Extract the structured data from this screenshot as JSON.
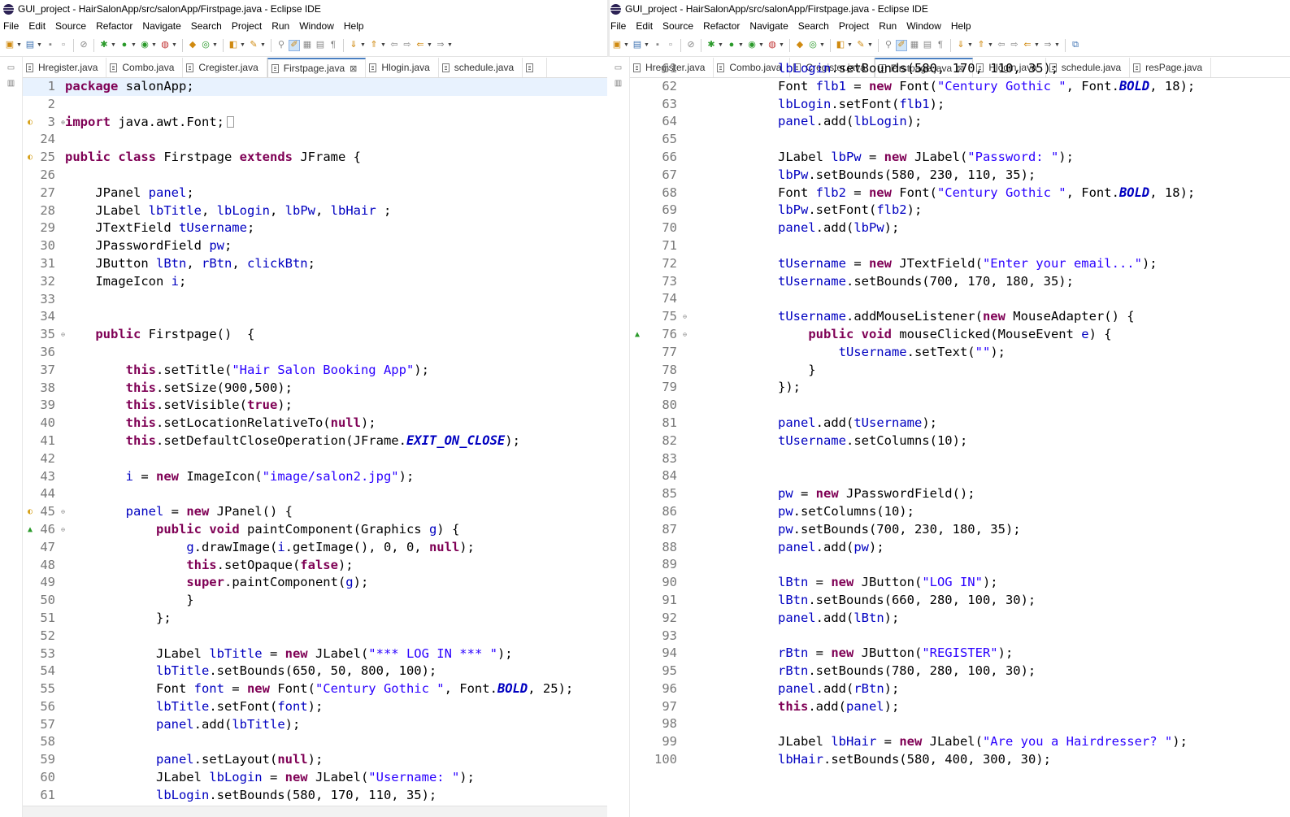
{
  "window_title": "GUI_project - HairSalonApp/src/salonApp/Firstpage.java - Eclipse IDE",
  "menu": [
    "File",
    "Edit",
    "Source",
    "Refactor",
    "Navigate",
    "Search",
    "Project",
    "Run",
    "Window",
    "Help"
  ],
  "left_tabs": [
    {
      "label": "Hregister.java",
      "active": false
    },
    {
      "label": "Combo.java",
      "active": false
    },
    {
      "label": "Cregister.java",
      "active": false
    },
    {
      "label": "Firstpage.java",
      "active": true
    },
    {
      "label": "Hlogin.java",
      "active": false
    },
    {
      "label": "schedule.java",
      "active": false
    }
  ],
  "right_tabs": [
    {
      "label": "Hregister.java",
      "active": false
    },
    {
      "label": "Combo.java",
      "active": false
    },
    {
      "label": "Cregister.java",
      "active": false
    },
    {
      "label": "Firstpage.java",
      "active": true
    },
    {
      "label": "Hlogin.java",
      "active": false
    },
    {
      "label": "schedule.java",
      "active": false
    },
    {
      "label": "resPage.java",
      "active": false
    }
  ],
  "close_glyph": "⊠",
  "left_code": [
    {
      "n": "1",
      "t": "package salonApp;",
      "current": true
    },
    {
      "n": "2",
      "t": ""
    },
    {
      "n": "3",
      "t": "import java.awt.Font;",
      "marker": "warn",
      "fold": "expand",
      "collapsed": true
    },
    {
      "n": "24",
      "t": ""
    },
    {
      "n": "25",
      "t": "public class Firstpage extends JFrame {",
      "marker": "warn"
    },
    {
      "n": "26",
      "t": ""
    },
    {
      "n": "27",
      "t": "    JPanel panel;"
    },
    {
      "n": "28",
      "t": "    JLabel lbTitle, lbLogin, lbPw, lbHair ;"
    },
    {
      "n": "29",
      "t": "    JTextField tUsername;"
    },
    {
      "n": "30",
      "t": "    JPasswordField pw;"
    },
    {
      "n": "31",
      "t": "    JButton lBtn, rBtn, clickBtn;"
    },
    {
      "n": "32",
      "t": "    ImageIcon i;"
    },
    {
      "n": "33",
      "t": ""
    },
    {
      "n": "34",
      "t": ""
    },
    {
      "n": "35",
      "t": "    public Firstpage()  {",
      "fold": "collapse"
    },
    {
      "n": "36",
      "t": ""
    },
    {
      "n": "37",
      "t": "        this.setTitle(\"Hair Salon Booking App\");"
    },
    {
      "n": "38",
      "t": "        this.setSize(900,500);"
    },
    {
      "n": "39",
      "t": "        this.setVisible(true);"
    },
    {
      "n": "40",
      "t": "        this.setLocationRelativeTo(null);"
    },
    {
      "n": "41",
      "t": "        this.setDefaultCloseOperation(JFrame.EXIT_ON_CLOSE);"
    },
    {
      "n": "42",
      "t": ""
    },
    {
      "n": "43",
      "t": "        i = new ImageIcon(\"image/salon2.jpg\");"
    },
    {
      "n": "44",
      "t": ""
    },
    {
      "n": "45",
      "t": "        panel = new JPanel() {",
      "marker": "warn",
      "fold": "collapse"
    },
    {
      "n": "46",
      "t": "            public void paintComponent(Graphics g) {",
      "marker": "up",
      "fold": "collapse"
    },
    {
      "n": "47",
      "t": "                g.drawImage(i.getImage(), 0, 0, null);"
    },
    {
      "n": "48",
      "t": "                this.setOpaque(false);"
    },
    {
      "n": "49",
      "t": "                super.paintComponent(g);"
    },
    {
      "n": "50",
      "t": "                }"
    },
    {
      "n": "51",
      "t": "            };"
    },
    {
      "n": "52",
      "t": ""
    },
    {
      "n": "53",
      "t": "            JLabel lbTitle = new JLabel(\"*** LOG IN *** \");"
    },
    {
      "n": "54",
      "t": "            lbTitle.setBounds(650, 50, 800, 100);"
    },
    {
      "n": "55",
      "t": "            Font font = new Font(\"Century Gothic \", Font.BOLD, 25);"
    },
    {
      "n": "56",
      "t": "            lbTitle.setFont(font);"
    },
    {
      "n": "57",
      "t": "            panel.add(lbTitle);"
    },
    {
      "n": "58",
      "t": ""
    },
    {
      "n": "59",
      "t": "            panel.setLayout(null);"
    },
    {
      "n": "60",
      "t": "            JLabel lbLogin = new JLabel(\"Username: \");"
    },
    {
      "n": "61",
      "t": "            lbLogin.setBounds(580, 170, 110, 35);"
    }
  ],
  "right_code": [
    {
      "n": "61",
      "t": "            lbLogin.setBounds(580, 170, 110, 35);"
    },
    {
      "n": "62",
      "t": "            Font flb1 = new Font(\"Century Gothic \", Font.BOLD, 18);"
    },
    {
      "n": "63",
      "t": "            lbLogin.setFont(flb1);"
    },
    {
      "n": "64",
      "t": "            panel.add(lbLogin);"
    },
    {
      "n": "65",
      "t": ""
    },
    {
      "n": "66",
      "t": "            JLabel lbPw = new JLabel(\"Password: \");"
    },
    {
      "n": "67",
      "t": "            lbPw.setBounds(580, 230, 110, 35);"
    },
    {
      "n": "68",
      "t": "            Font flb2 = new Font(\"Century Gothic \", Font.BOLD, 18);"
    },
    {
      "n": "69",
      "t": "            lbPw.setFont(flb2);"
    },
    {
      "n": "70",
      "t": "            panel.add(lbPw);"
    },
    {
      "n": "71",
      "t": ""
    },
    {
      "n": "72",
      "t": "            tUsername = new JTextField(\"Enter your email...\");"
    },
    {
      "n": "73",
      "t": "            tUsername.setBounds(700, 170, 180, 35);"
    },
    {
      "n": "74",
      "t": ""
    },
    {
      "n": "75",
      "t": "            tUsername.addMouseListener(new MouseAdapter() {",
      "fold": "collapse"
    },
    {
      "n": "76",
      "t": "                public void mouseClicked(MouseEvent e) {",
      "marker": "up",
      "fold": "collapse"
    },
    {
      "n": "77",
      "t": "                    tUsername.setText(\"\");"
    },
    {
      "n": "78",
      "t": "                }"
    },
    {
      "n": "79",
      "t": "            });"
    },
    {
      "n": "80",
      "t": ""
    },
    {
      "n": "81",
      "t": "            panel.add(tUsername);"
    },
    {
      "n": "82",
      "t": "            tUsername.setColumns(10);"
    },
    {
      "n": "83",
      "t": ""
    },
    {
      "n": "84",
      "t": ""
    },
    {
      "n": "85",
      "t": "            pw = new JPasswordField();"
    },
    {
      "n": "86",
      "t": "            pw.setColumns(10);"
    },
    {
      "n": "87",
      "t": "            pw.setBounds(700, 230, 180, 35);"
    },
    {
      "n": "88",
      "t": "            panel.add(pw);"
    },
    {
      "n": "89",
      "t": ""
    },
    {
      "n": "90",
      "t": "            lBtn = new JButton(\"LOG IN\");"
    },
    {
      "n": "91",
      "t": "            lBtn.setBounds(660, 280, 100, 30);"
    },
    {
      "n": "92",
      "t": "            panel.add(lBtn);"
    },
    {
      "n": "93",
      "t": ""
    },
    {
      "n": "94",
      "t": "            rBtn = new JButton(\"REGISTER\");"
    },
    {
      "n": "95",
      "t": "            rBtn.setBounds(780, 280, 100, 30);"
    },
    {
      "n": "96",
      "t": "            panel.add(rBtn);"
    },
    {
      "n": "97",
      "t": "            this.add(panel);"
    },
    {
      "n": "98",
      "t": ""
    },
    {
      "n": "99",
      "t": "            JLabel lbHair = new JLabel(\"Are you a Hairdresser? \");"
    },
    {
      "n": "100",
      "t": "            lbHair.setBounds(580, 400, 300, 30);"
    }
  ],
  "colors": {
    "keyword": "#7f0055",
    "string": "#2a00ff",
    "field": "#0000c0",
    "line_number": "#787878",
    "current_line": "#e8f2fe",
    "active_tab_accent": "#4a7fc1"
  }
}
